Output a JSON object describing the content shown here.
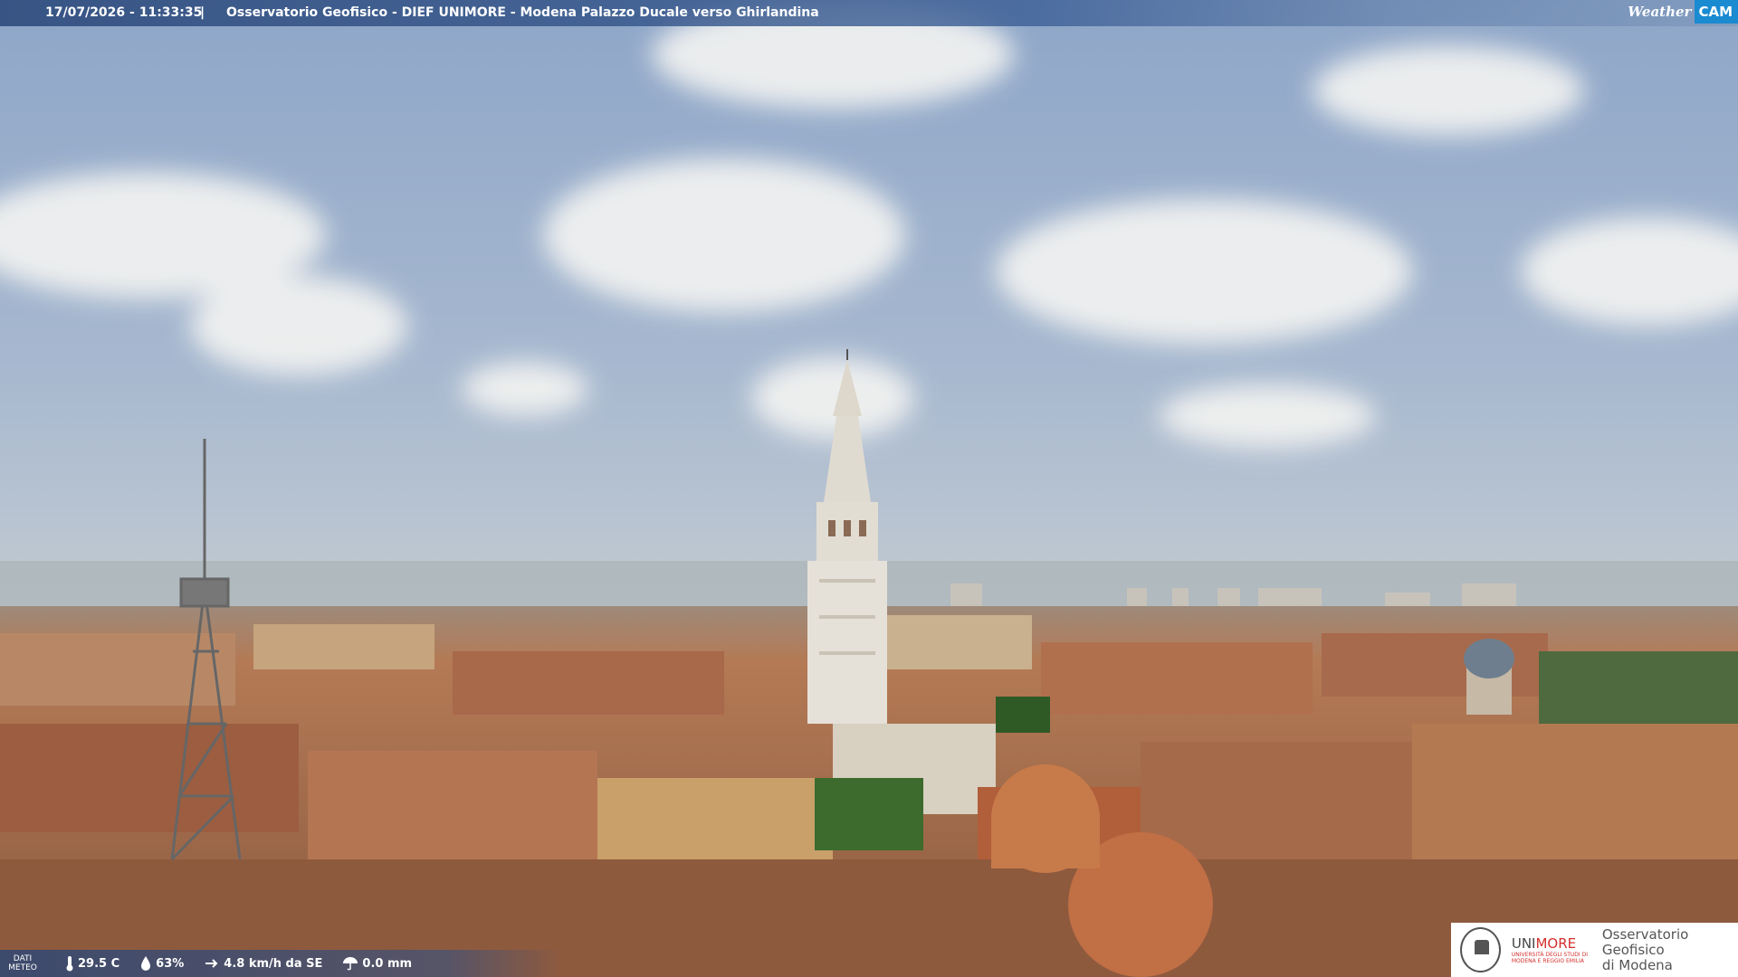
{
  "overlay": {
    "timestamp": "17/07/2026 - 11:33:35",
    "separator": "|",
    "title": "Osservatorio Geofisico - DIEF UNIMORE - Modena Palazzo Ducale verso Ghirlandina",
    "logo_weather": "Weather",
    "logo_cam": "CAM"
  },
  "weather": {
    "label_line1": "DATI",
    "label_line2": "METEO",
    "temperature": "29.5 C",
    "humidity": "63%",
    "wind": "4.8 km/h da SE",
    "rain": "0.0 mm"
  },
  "branding": {
    "university_uni": "UNI",
    "university_more": "MORE",
    "university_sub": "UNIVERSITÀ DEGLI STUDI DI MODENA E REGGIO EMILIA",
    "observatory_line1": "Osservatorio Geofisico",
    "observatory_line2": "di Modena"
  },
  "colors": {
    "sky_top": "#8ea6c8",
    "sky_horizon": "#b9c6d2",
    "roof": "#b8754f",
    "tower": "#e4e0d8",
    "accent_blue": "#1a8ad1",
    "unimore_red": "#d4302e"
  }
}
